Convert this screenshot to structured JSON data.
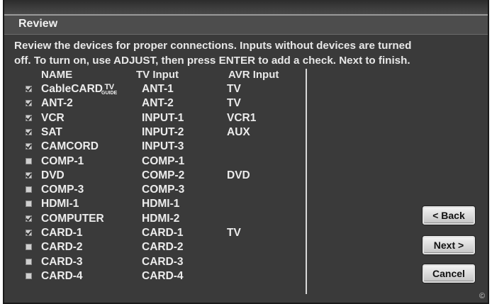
{
  "window": {
    "title": "Review",
    "instructions": [
      "Review the devices for proper connections. Inputs without devices are turned",
      "off. To turn on, use ADJUST, then press ENTER to add a check.  Next to finish."
    ]
  },
  "columns": {
    "name": "NAME",
    "tv_input": "TV  Input",
    "avr_input": "AVR Input"
  },
  "tv_guide_logo": {
    "line1": "TV",
    "line2": "GUIDE"
  },
  "devices": [
    {
      "checked": true,
      "name": "CableCARD",
      "tv_input": "ANT-1",
      "avr_input": "TV"
    },
    {
      "checked": true,
      "name": "ANT-2",
      "tv_input": "ANT-2",
      "avr_input": "TV"
    },
    {
      "checked": true,
      "name": "VCR",
      "tv_input": "INPUT-1",
      "avr_input": "VCR1"
    },
    {
      "checked": true,
      "name": "SAT",
      "tv_input": "INPUT-2",
      "avr_input": "AUX"
    },
    {
      "checked": true,
      "name": "CAMCORD",
      "tv_input": "INPUT-3",
      "avr_input": ""
    },
    {
      "checked": false,
      "name": "COMP-1",
      "tv_input": "COMP-1",
      "avr_input": ""
    },
    {
      "checked": true,
      "name": "DVD",
      "tv_input": "COMP-2",
      "avr_input": "DVD"
    },
    {
      "checked": false,
      "name": "COMP-3",
      "tv_input": "COMP-3",
      "avr_input": ""
    },
    {
      "checked": false,
      "name": "HDMI-1",
      "tv_input": "HDMI-1",
      "avr_input": ""
    },
    {
      "checked": true,
      "name": "COMPUTER",
      "tv_input": "HDMI-2",
      "avr_input": ""
    },
    {
      "checked": true,
      "name": "CARD-1",
      "tv_input": "CARD-1",
      "avr_input": "TV"
    },
    {
      "checked": false,
      "name": "CARD-2",
      "tv_input": "CARD-2",
      "avr_input": ""
    },
    {
      "checked": false,
      "name": "CARD-3",
      "tv_input": "CARD-3",
      "avr_input": ""
    },
    {
      "checked": false,
      "name": "CARD-4",
      "tv_input": "CARD-4",
      "avr_input": ""
    }
  ],
  "buttons": {
    "back": "< Back",
    "next": "Next >",
    "cancel": "Cancel"
  },
  "copyright": "©"
}
